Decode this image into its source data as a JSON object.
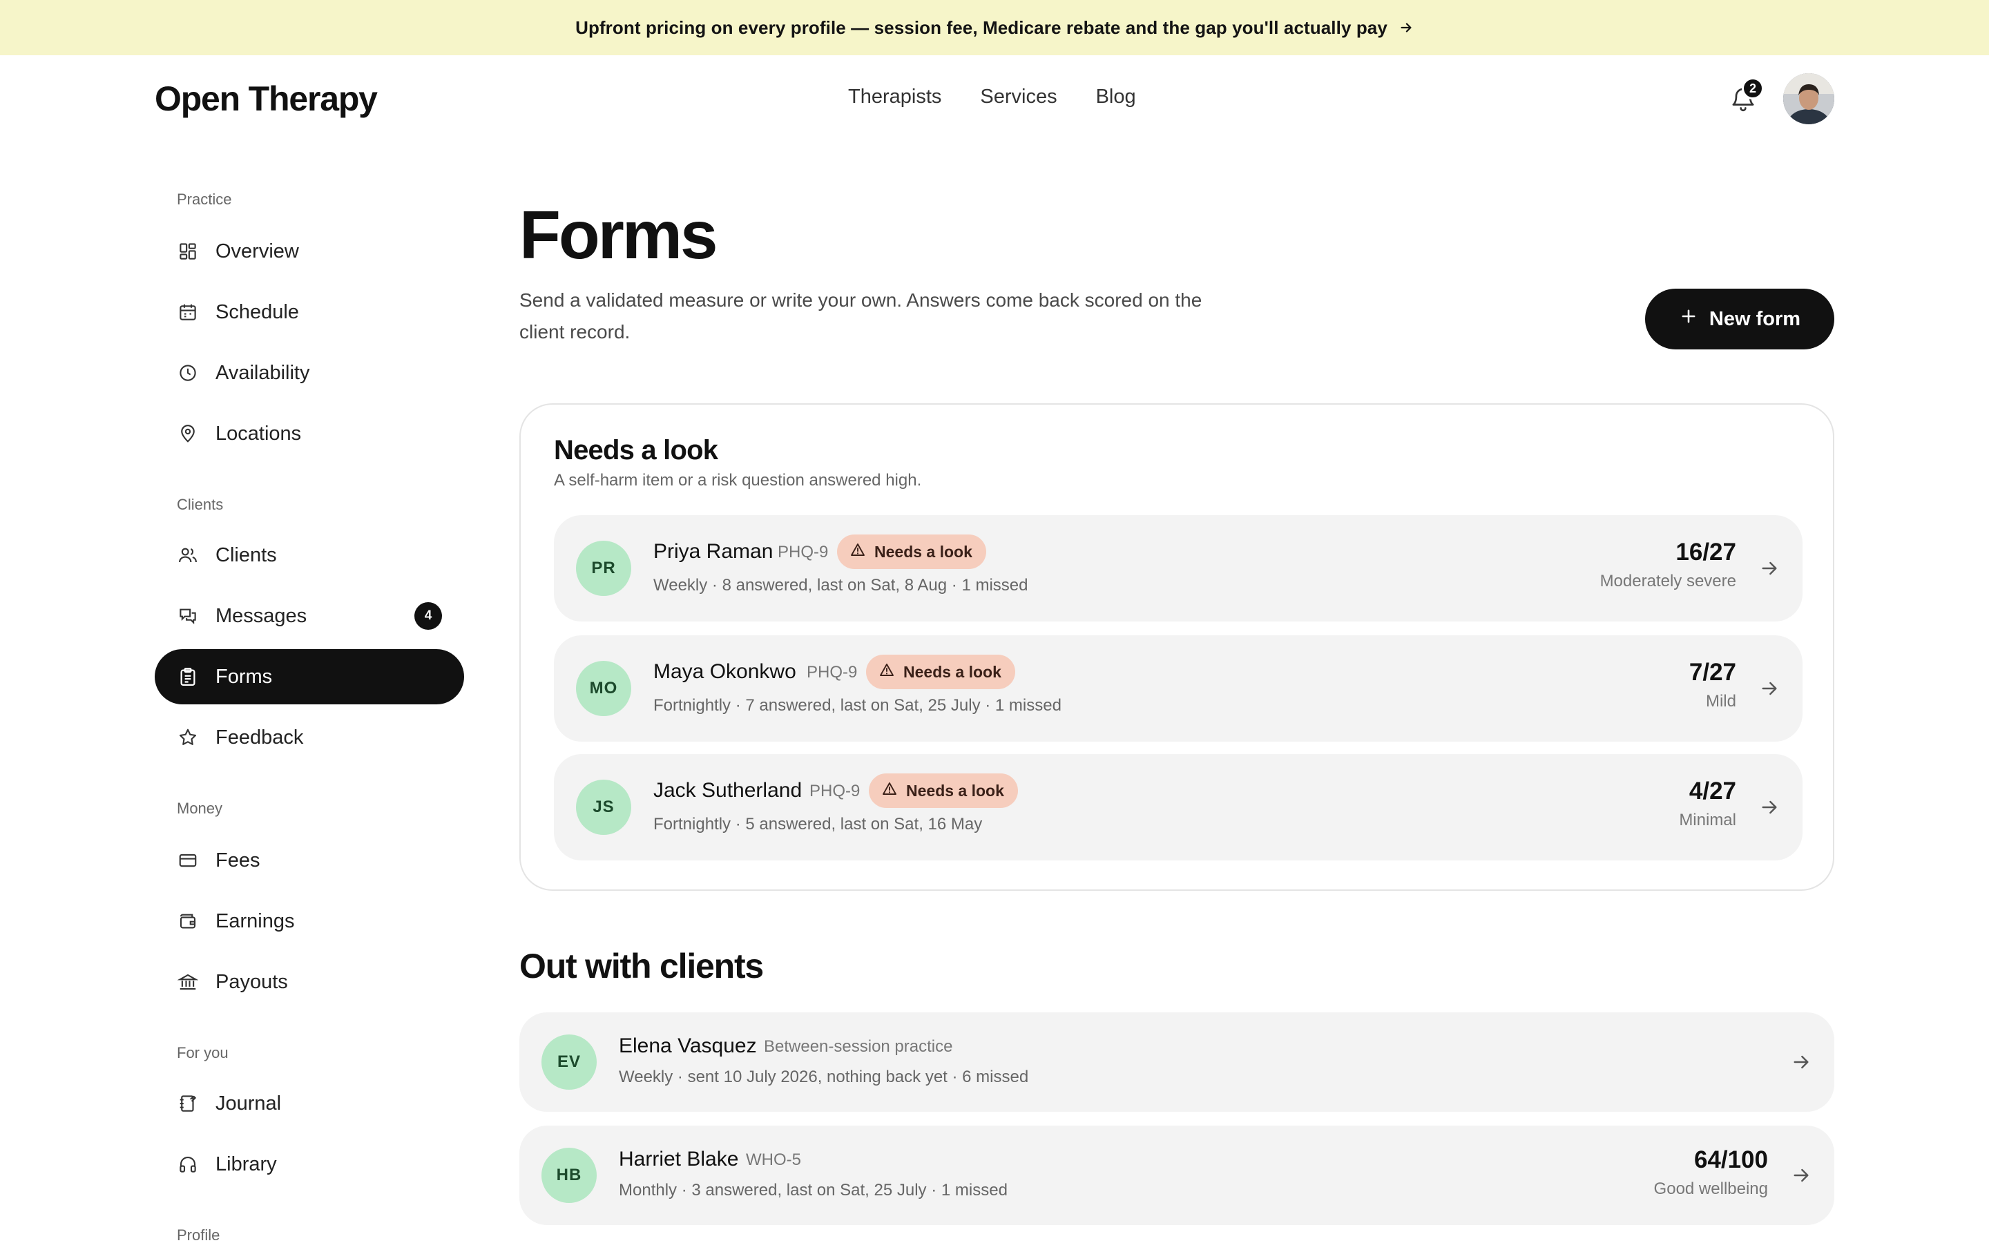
{
  "banner": {
    "text": "Upfront pricing on every profile — session fee, Medicare rebate and the gap you'll actually pay"
  },
  "brand": {
    "name": "Open Therapy"
  },
  "topnav": {
    "items": [
      "Therapists",
      "Services",
      "Blog"
    ]
  },
  "notifications": {
    "count": "2"
  },
  "sidebar": {
    "sections": {
      "practice": "Practice",
      "clients": "Clients",
      "money": "Money",
      "for_you": "For you",
      "profile": "Profile"
    },
    "items": [
      {
        "label": "Overview",
        "icon": "grid-icon"
      },
      {
        "label": "Schedule",
        "icon": "calendar-icon"
      },
      {
        "label": "Availability",
        "icon": "clock-icon"
      },
      {
        "label": "Locations",
        "icon": "pin-icon"
      },
      {
        "label": "Clients",
        "icon": "users-icon"
      },
      {
        "label": "Messages",
        "icon": "chat-icon",
        "badge": "4"
      },
      {
        "label": "Forms",
        "icon": "clipboard-icon",
        "active": true
      },
      {
        "label": "Feedback",
        "icon": "star-icon"
      },
      {
        "label": "Fees",
        "icon": "card-icon"
      },
      {
        "label": "Earnings",
        "icon": "wallet-icon"
      },
      {
        "label": "Payouts",
        "icon": "bank-icon"
      },
      {
        "label": "Journal",
        "icon": "journal-icon"
      },
      {
        "label": "Library",
        "icon": "headphones-icon"
      }
    ]
  },
  "main": {
    "title": "Forms",
    "description": "Send a validated measure or write your own. Answers come back scored on the client record.",
    "new_form_label": "New form",
    "needs_look": {
      "title": "Needs a look",
      "subtitle": "A self-harm item or a risk question answered high.",
      "rows": [
        {
          "initials": "PR",
          "name": "Priya Raman",
          "form": "PHQ-9",
          "flag": "Needs a look",
          "meta": "Weekly · 8 answered, last on Sat, 8 Aug · 1 missed",
          "score": "16/27",
          "severity": "Moderately severe"
        },
        {
          "initials": "MO",
          "name": "Maya Okonkwo",
          "form": "PHQ-9",
          "flag": "Needs a look",
          "meta": "Fortnightly · 7 answered, last on Sat, 25 July · 1 missed",
          "score": "7/27",
          "severity": "Mild"
        },
        {
          "initials": "JS",
          "name": "Jack Sutherland",
          "form": "PHQ-9",
          "flag": "Needs a look",
          "meta": "Fortnightly · 5 answered, last on Sat, 16 May",
          "score": "4/27",
          "severity": "Minimal"
        }
      ]
    },
    "out_with_clients": {
      "title": "Out with clients",
      "rows": [
        {
          "initials": "EV",
          "name": "Elena Vasquez",
          "form": "Between-session practice",
          "meta": "Weekly · sent 10 July 2026, nothing back yet · 6 missed",
          "score": "",
          "severity": ""
        },
        {
          "initials": "HB",
          "name": "Harriet Blake",
          "form": "WHO-5",
          "meta": "Monthly · 3 answered, last on Sat, 25 July · 1 missed",
          "score": "64/100",
          "severity": "Good wellbeing"
        }
      ]
    }
  },
  "colors": {
    "accent": "#111111",
    "banner": "#f6f5c9",
    "avatar_green": "#b6e8c6",
    "flag_pill": "#f6cdbd",
    "row_bg": "#f3f3f3"
  }
}
